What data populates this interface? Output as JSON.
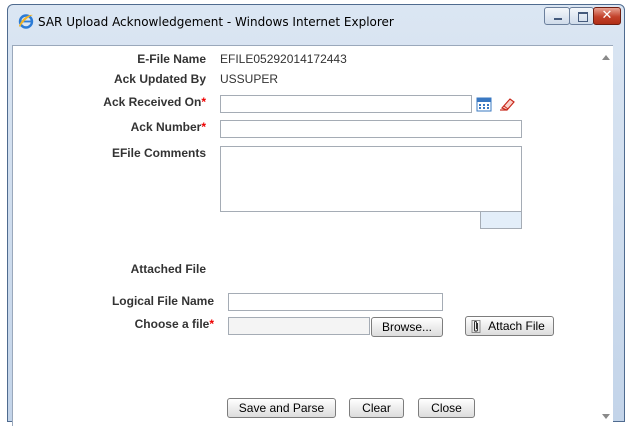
{
  "window": {
    "title": "SAR Upload Acknowledgement - Windows Internet Explorer"
  },
  "form": {
    "efile_name_label": "E-File Name",
    "efile_name_value": "EFILE05292014172443",
    "ack_updated_by_label": "Ack Updated By",
    "ack_updated_by_value": "USSUPER",
    "ack_received_on_label": "Ack Received On",
    "ack_received_on_value": "",
    "ack_number_label": "Ack Number",
    "ack_number_value": "",
    "efile_comments_label": "EFile Comments",
    "efile_comments_value": "",
    "required_marker": "*"
  },
  "attachment": {
    "section_label": "Attached File",
    "logical_file_name_label": "Logical File Name",
    "logical_file_name_value": "",
    "choose_file_label": "Choose a file",
    "choose_file_value": "",
    "browse_label": "Browse...",
    "attach_file_label": "Attach File"
  },
  "actions": {
    "save_and_parse_label": "Save and Parse",
    "clear_label": "Clear",
    "close_label": "Close"
  },
  "colors": {
    "required": "#ee0000",
    "close_button": "#c3412a",
    "calendar_icon": "#3a78c2"
  }
}
